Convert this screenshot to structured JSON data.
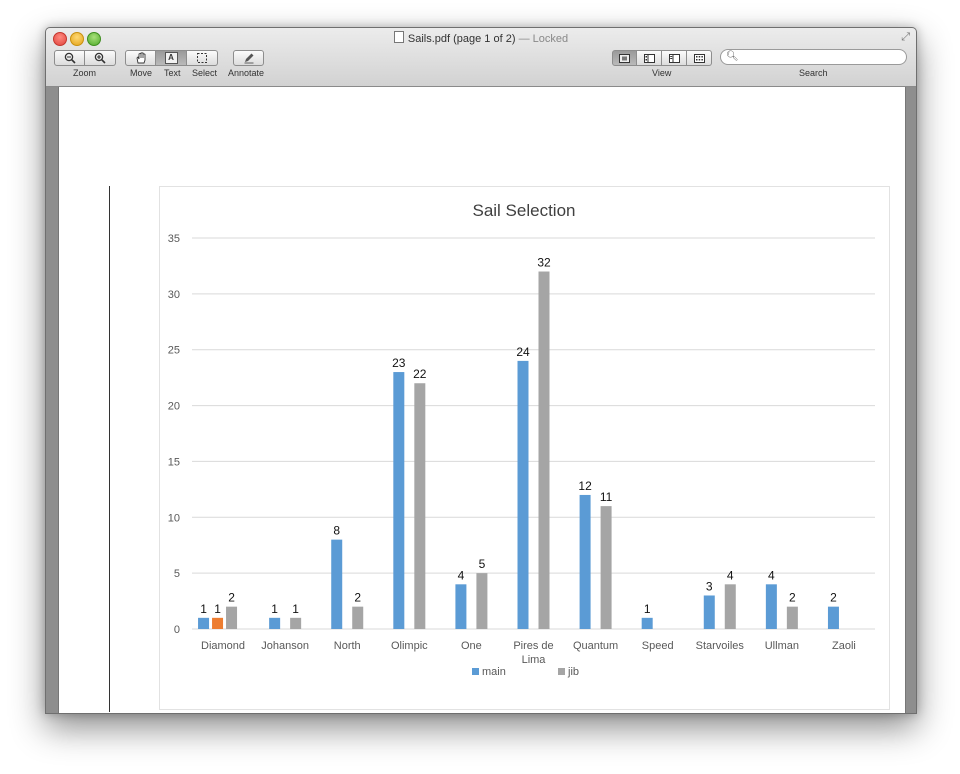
{
  "window": {
    "title": "Sails.pdf (page 1 of 2)",
    "title_separator": "—",
    "title_status": "Locked"
  },
  "toolbar": {
    "zoom_label": "Zoom",
    "move_label": "Move",
    "text_label": "Text",
    "select_label": "Select",
    "annotate_label": "Annotate",
    "view_label": "View",
    "search_label": "Search",
    "search_value": "",
    "text_tool_glyph": "A"
  },
  "icons": {
    "zoom_out": "zoom-out-icon",
    "zoom_in": "zoom-in-icon",
    "move": "hand-icon",
    "text": "text-cursor-icon",
    "select": "marquee-select-icon",
    "annotate": "pencil-icon",
    "search": "magnifier-icon",
    "fullscreen": "fullscreen-icon"
  },
  "colors": {
    "main": "#5b9bd5",
    "jib": "#a5a5a5",
    "highlight": "#ed7d31",
    "gridline": "#d9d9d9"
  },
  "chart_data": {
    "type": "bar",
    "title": "Sail Selection",
    "categories": [
      "Diamond",
      "Johanson",
      "North",
      "Olimpic",
      "One",
      "Pires de Lima",
      "Quantum",
      "Speed",
      "Starvoiles",
      "Ullman",
      "Zaoli"
    ],
    "series": [
      {
        "name": "main",
        "values": [
          1,
          1,
          8,
          23,
          4,
          24,
          12,
          1,
          3,
          4,
          2
        ]
      },
      {
        "name": "jib",
        "values": [
          2,
          1,
          2,
          22,
          5,
          32,
          11,
          null,
          4,
          2,
          null
        ]
      }
    ],
    "extra_bars": [
      {
        "category": "Diamond",
        "value": 1,
        "color": "#ed7d31"
      }
    ],
    "ylim": [
      0,
      35
    ],
    "yticks": [
      0,
      5,
      10,
      15,
      20,
      25,
      30,
      35
    ],
    "grid": true,
    "data_labels": true,
    "legend_position": "bottom"
  }
}
